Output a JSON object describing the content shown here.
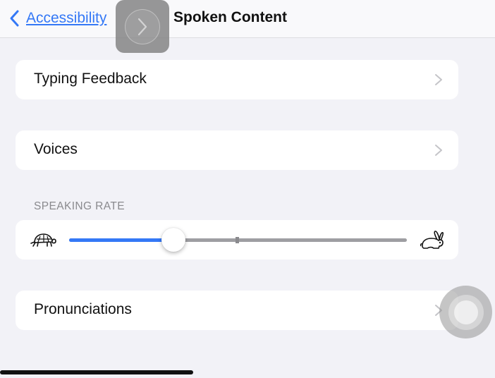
{
  "navbar": {
    "back_label": "Accessibility",
    "title": "Spoken Content"
  },
  "cells": {
    "typing_feedback": "Typing Feedback",
    "voices": "Voices",
    "pronunciations": "Pronunciations"
  },
  "speaking_rate": {
    "header": "SPEAKING RATE",
    "value_fraction": 0.31,
    "slow_icon": "turtle-icon",
    "fast_icon": "rabbit-icon"
  },
  "colors": {
    "accent": "#3478f6",
    "background": "#f2f2f7",
    "cell": "#ffffff"
  }
}
